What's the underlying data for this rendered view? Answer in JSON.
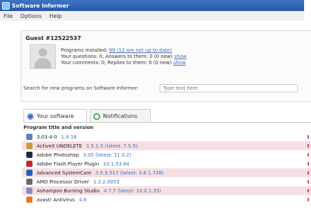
{
  "window": {
    "title": "Software Informer"
  },
  "menu": [
    "File",
    "Options",
    "Help"
  ],
  "user": {
    "name": "Guest #12522537",
    "stats": [
      {
        "text": "Programs installed: ",
        "link": "99 (12 are not up to date)"
      },
      {
        "text": "Your questions: 0, Answers to them: 0 (0 new) ",
        "link": "show"
      },
      {
        "text": "Your comments: 0, Replies to them: 0 (0 new) ",
        "link": "show"
      }
    ]
  },
  "search": {
    "label": "Search for new programs on Software Informer:",
    "placeholder": "Type text here"
  },
  "tabs": [
    {
      "label": "Your software",
      "icon": "software-icon",
      "active": true
    },
    {
      "label": "Notifications",
      "icon": "notifications-icon",
      "active": false
    }
  ],
  "list": {
    "header": "Program title and version",
    "rows": [
      {
        "name": "3.03-4-0",
        "version": "1.9.16",
        "highlight": false,
        "icon_color": "#5a7fc0"
      },
      {
        "name": "ActiveX UNDELETE",
        "version": "1.5.1.5  (latest: 7.5.5)",
        "highlight": true,
        "icon_color": "#c89a3a"
      },
      {
        "name": "Adobe Photoshop",
        "version": "3.05  (latest: 11.0.2)",
        "highlight": false,
        "icon_color": "#1c2a4a"
      },
      {
        "name": "Adobe Flash Player Plugin",
        "version": "10.1.53.64",
        "highlight": false,
        "icon_color": "#c8282a"
      },
      {
        "name": "Advanced SystemCare",
        "version": "3.5.5.517  (latest: 3.6.1.728)",
        "highlight": true,
        "icon_color": "#2a5db8"
      },
      {
        "name": "AMD Processor Driver",
        "version": "1.3.2.0053",
        "highlight": false,
        "icon_color": "#6a6a6a"
      },
      {
        "name": "Ashampoo Burning Studio",
        "version": "4.7.7  (latest: 10.0.1.35)",
        "highlight": true,
        "icon_color": "#8a8abc"
      },
      {
        "name": "avast! Antivirus",
        "version": "4.8",
        "highlight": false,
        "icon_color": "#e07a20"
      }
    ]
  }
}
